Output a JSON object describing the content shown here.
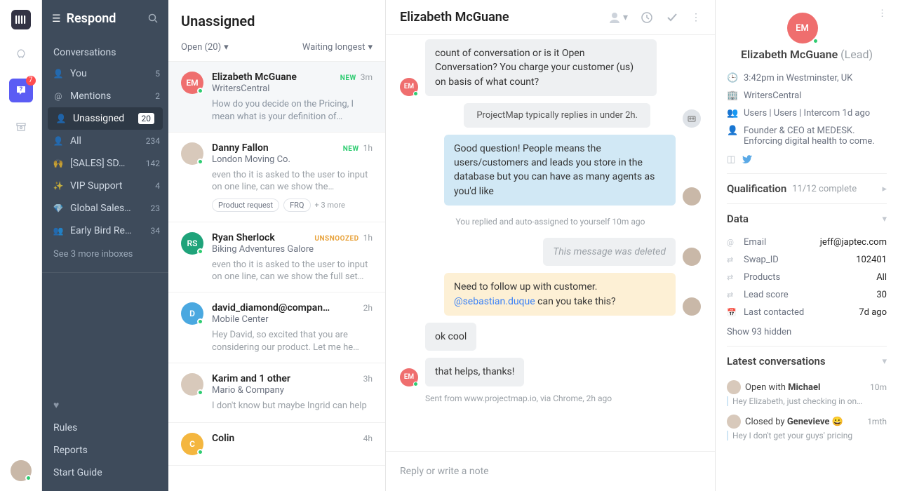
{
  "rail": {
    "help_badge": "7"
  },
  "sidebar": {
    "title": "Respond",
    "conversations_label": "Conversations",
    "items": [
      {
        "icon": "👤",
        "label": "You",
        "count": "5"
      },
      {
        "icon": "@",
        "label": "Mentions",
        "count": "2"
      },
      {
        "icon": "👤",
        "label": "Unassigned",
        "count": "20",
        "active": true
      },
      {
        "icon": "👤",
        "label": "All",
        "count": "234"
      },
      {
        "icon": "🙌",
        "label": "[SALES] SD…",
        "count": "142"
      },
      {
        "icon": "✨",
        "label": "VIP Support",
        "count": "4"
      },
      {
        "icon": "💎",
        "label": "Global Sales…",
        "count": "23"
      },
      {
        "icon": "👥",
        "label": "Early Bird Re…",
        "count": "34"
      }
    ],
    "see_more": "See 3 more inboxes",
    "bottom": [
      "Rules",
      "Reports",
      "Start Guide"
    ]
  },
  "list": {
    "title": "Unassigned",
    "filter_left": "Open (20)",
    "filter_right": "Waiting longest",
    "items": [
      {
        "avatar": "EM",
        "color": "#ef6e6e",
        "name": "Elizabeth McGuane",
        "company": "WritersCentral",
        "tag": "NEW",
        "time": "3m",
        "preview": "How do you decide on the Pricing, I mean what is your definition of…",
        "selected": true
      },
      {
        "avatar": "",
        "color": "#d8c9bb",
        "name": "Danny Fallon",
        "company": "London Moving Co.",
        "tag": "NEW",
        "time": "1h",
        "preview": "even tho it is asked to the user to input on one line, can we show the…",
        "chips": [
          "Product request",
          "FRQ"
        ],
        "more_chips": "+ 3 more"
      },
      {
        "avatar": "RS",
        "color": "#1fa37a",
        "name": "Ryan Sherlock",
        "company": "Biking Adventures Galore",
        "tag": "UNSNOOZED",
        "time": "1h",
        "preview": "even tho it is asked to the user to input on one line, can we show the full set…"
      },
      {
        "avatar": "D",
        "color": "#4aa8e0",
        "name": "david_diamond@compan…",
        "company": "Mobile Center",
        "time": "2h",
        "preview": "Hey David, so excited that you are considering our product. Let me he…"
      },
      {
        "avatar": "",
        "color": "#d8c9bb",
        "name": "Karim and 1 other",
        "company": "Mario & Company",
        "time": "3h",
        "preview": "I don't know but maybe Ingrid can help"
      },
      {
        "avatar": "C",
        "color": "#f4b63f",
        "name": "Colin",
        "company": "",
        "time": "4h",
        "preview": ""
      }
    ]
  },
  "thread": {
    "title": "Elizabeth McGuane",
    "messages": [
      {
        "side": "left",
        "avatar": "EM",
        "color": "#ef6e6e",
        "style": "gray",
        "text": "count of conversation or is it Open Conversation? You charge your customer (us) on basis of what count?"
      },
      {
        "side": "right",
        "style": "pill",
        "text": "ProjectMap typically replies in under 2h.",
        "iconright": true
      },
      {
        "side": "right",
        "avatar": "img",
        "style": "blue",
        "text": "Good question! People means the users/customers and leads you store in the database but you can have as many agents as you'd like"
      },
      {
        "system": "You replied and auto-assigned to yourself 10m ago"
      },
      {
        "side": "right",
        "avatar": "img",
        "style": "gray",
        "class": "deleted",
        "text": "This message was deleted"
      },
      {
        "side": "right",
        "avatar": "img",
        "style": "note",
        "pre": "Need to follow up with customer. ",
        "mention": "@sebastian.duque",
        "post": " can you take this?"
      },
      {
        "side": "left",
        "style": "gray",
        "text": "ok cool",
        "noav": true
      },
      {
        "side": "left",
        "avatar": "EM",
        "color": "#ef6e6e",
        "style": "gray",
        "text": "that helps, thanks!"
      }
    ],
    "sent_from": "Sent from www.projectmap.io, via Chrome, 2h ago",
    "composer_placeholder": "Reply or write a note"
  },
  "details": {
    "name": "Elizabeth McGuane",
    "type": "(Lead)",
    "avatar": "EM",
    "meta": [
      {
        "icon": "🕒",
        "text": "3:42pm in Westminster, UK"
      },
      {
        "icon": "🏢",
        "text": "WritersCentral"
      },
      {
        "icon": "👥",
        "text": "Users | Users | Intercom 1d ago"
      },
      {
        "icon": "👤",
        "text": "Founder & CEO at MEDESK. Enforcing digital health to come."
      }
    ],
    "qualification": {
      "title": "Qualification",
      "sub": "11/12 complete"
    },
    "data_title": "Data",
    "data": [
      {
        "icon": "@",
        "key": "Email",
        "value": "jeff@japtec.com"
      },
      {
        "icon": "⇄",
        "key": "Swap_ID",
        "value": "102401"
      },
      {
        "icon": "⇄",
        "key": "Products",
        "value": "All"
      },
      {
        "icon": "⇄",
        "key": "Lead score",
        "value": "30"
      },
      {
        "icon": "📅",
        "key": "Last contacted",
        "value": "7d ago"
      }
    ],
    "show_hidden": "Show 93 hidden",
    "latest_title": "Latest conversations",
    "latest": [
      {
        "status": "Open with ",
        "who": "Michael",
        "time": "10m",
        "snippet": "Hey Elizabeth, just checking in on…"
      },
      {
        "status": "Closed by ",
        "who": "Genevieve",
        "emoji": "😀",
        "time": "1mth",
        "snippet": "Hey I don't get your guys' pricing"
      }
    ]
  }
}
